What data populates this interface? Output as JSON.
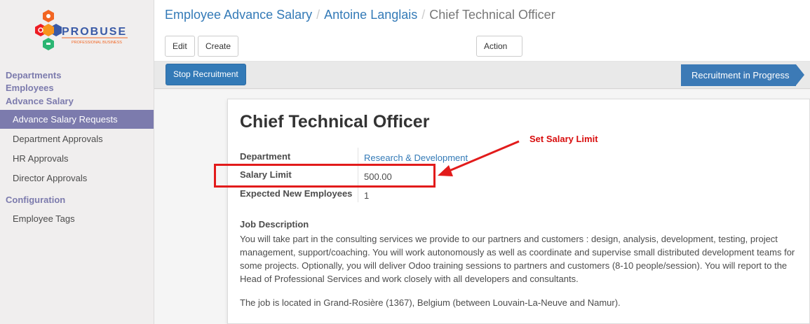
{
  "brand": {
    "name": "PROBUSE",
    "tagline": "PROFESSIONAL BUSINESS",
    "colors": {
      "orange": "#f26522",
      "red": "#ed1c24",
      "green": "#2bb673",
      "blue": "#3a5aa6"
    }
  },
  "sidebar": {
    "sections": [
      {
        "label": "Departments"
      },
      {
        "label": "Employees"
      },
      {
        "label": "Advance Salary"
      }
    ],
    "items": [
      {
        "label": "Advance Salary Requests",
        "active": true
      },
      {
        "label": "Department Approvals"
      },
      {
        "label": "HR Approvals"
      },
      {
        "label": "Director Approvals"
      }
    ],
    "config_section": "Configuration",
    "config_items": [
      {
        "label": "Employee Tags"
      }
    ]
  },
  "breadcrumb": {
    "items": [
      "Employee Advance Salary",
      "Antoine Langlais"
    ],
    "current": "Chief Technical Officer",
    "separator": "/"
  },
  "toolbar": {
    "edit": "Edit",
    "create": "Create",
    "action": "Action"
  },
  "statusbar": {
    "button": "Stop Recruitment",
    "stage": "Recruitment in Progress"
  },
  "form": {
    "title": "Chief Technical Officer",
    "fields": [
      {
        "label": "Department",
        "value": "Research & Development"
      },
      {
        "label": "Salary Limit",
        "value": "500.00"
      },
      {
        "label": "Expected New Employees",
        "value": "1"
      }
    ],
    "job_description_title": "Job Description",
    "job_description": "You will take part in the consulting services we provide to our partners and customers : design, analysis, development, testing, project management, support/coaching. You will work autonomously as well as coordinate and supervise small distributed development teams for some projects. Optionally, you will deliver Odoo training sessions to partners and customers (8-10 people/session). You will report to the Head of Professional Services and work closely with all developers and consultants.",
    "job_location": "The job is located in Grand-Rosière (1367), Belgium (between Louvain-La-Neuve and Namur)."
  },
  "annotation": {
    "text": "Set Salary Limit",
    "color": "#e21b1b"
  }
}
